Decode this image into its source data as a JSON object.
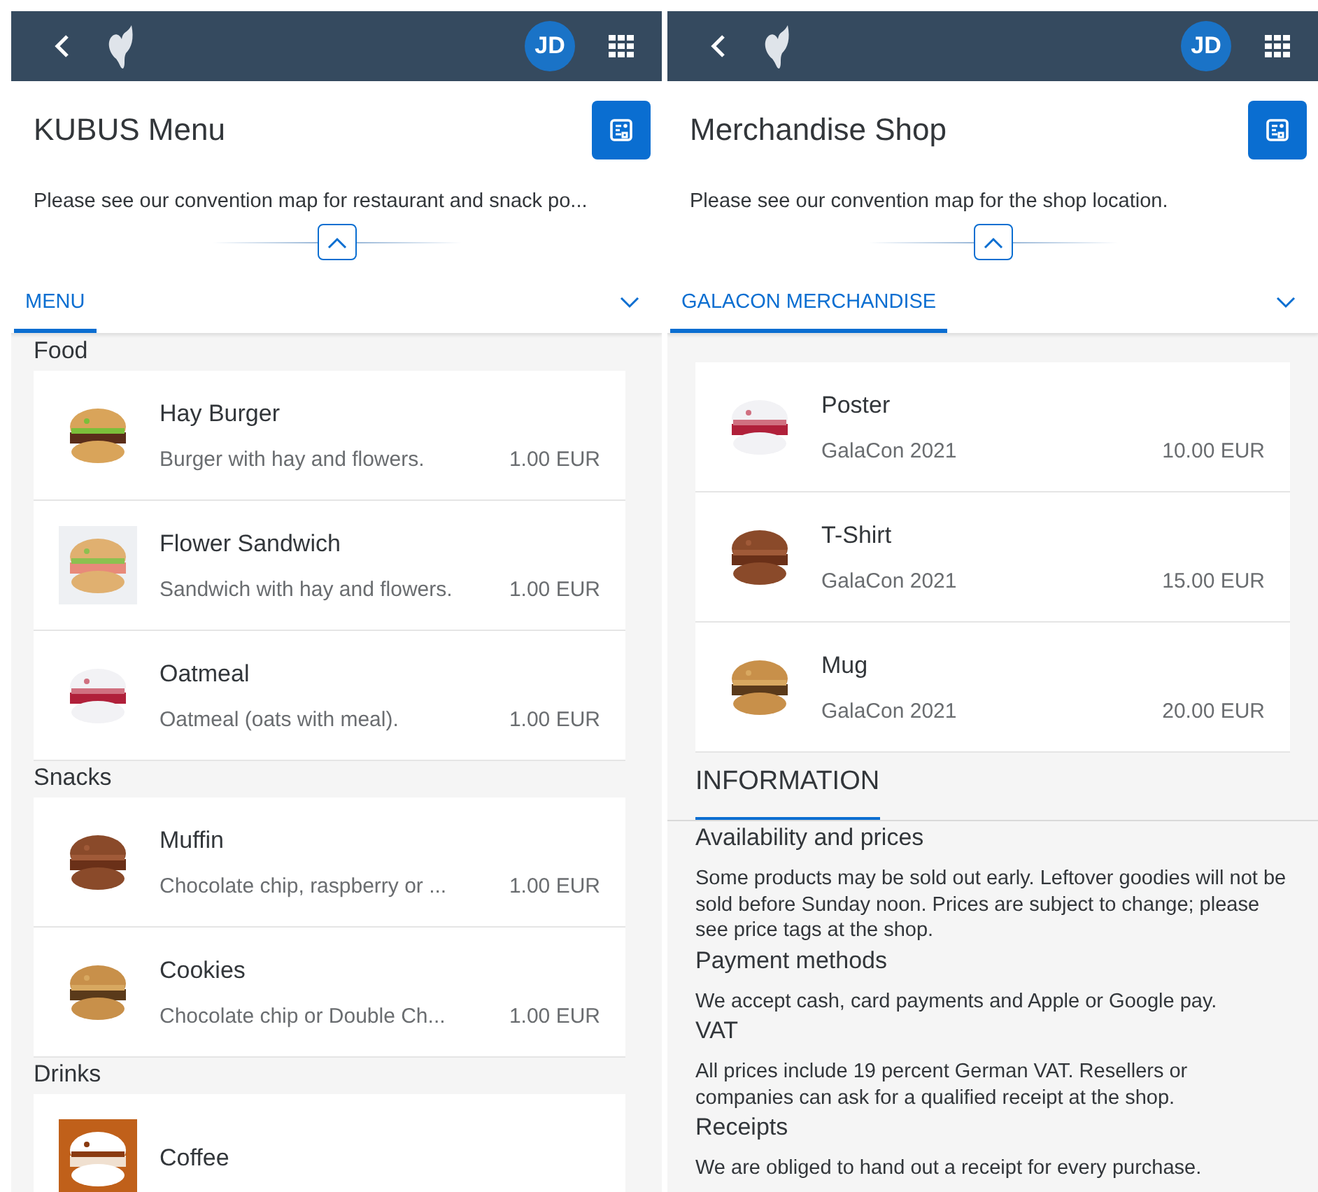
{
  "screens": [
    {
      "avatar": "JD",
      "title": "KUBUS Menu",
      "description": "Please see our convention map for restaurant and snack po...",
      "tabs": [
        {
          "label": "MENU",
          "selected": true
        }
      ],
      "groups": [
        {
          "title": "Food",
          "items": [
            {
              "name": "Hay Burger",
              "description": "Burger with hay and flowers.",
              "price": "1.00 EUR"
            },
            {
              "name": "Flower Sandwich",
              "description": "Sandwich with hay and flowers.",
              "price": "1.00 EUR"
            },
            {
              "name": "Oatmeal",
              "description": "Oatmeal (oats with meal).",
              "price": "1.00 EUR"
            }
          ]
        },
        {
          "title": "Snacks",
          "items": [
            {
              "name": "Muffin",
              "description": "Chocolate chip, raspberry or ...",
              "price": "1.00 EUR"
            },
            {
              "name": "Cookies",
              "description": "Chocolate chip or Double Ch...",
              "price": "1.00 EUR"
            }
          ]
        },
        {
          "title": "Drinks",
          "items": [
            {
              "name": "Coffee"
            }
          ]
        }
      ]
    },
    {
      "avatar": "JD",
      "title": "Merchandise Shop",
      "description": "Please see our convention map for the shop location.",
      "tabs": [
        {
          "label": "GALACON MERCHANDISE",
          "selected": true
        }
      ],
      "groups": [
        {
          "items": [
            {
              "name": "Poster",
              "description": "GalaCon 2021",
              "price": "10.00 EUR"
            },
            {
              "name": "T-Shirt",
              "description": "GalaCon 2021",
              "price": "15.00 EUR"
            },
            {
              "name": "Mug",
              "description": "GalaCon 2021",
              "price": "20.00 EUR"
            }
          ]
        }
      ],
      "info": {
        "tab": {
          "label": "INFORMATION",
          "selected": true
        },
        "sections": [
          {
            "heading": "Availability and prices",
            "text": "Some products may be sold out early. Leftover goodies will not be sold before Sunday noon. Prices are subject to change; please see price tags at the shop."
          },
          {
            "heading": "Payment methods",
            "text": "We accept cash, card payments and Apple or Google pay."
          },
          {
            "heading": "VAT",
            "text": "All prices include 19 percent German VAT. Resellers or companies can ask for a qualified receipt at the shop."
          },
          {
            "heading": "Receipts",
            "text": "We are obliged to hand out a receipt for every purchase."
          }
        ]
      }
    }
  ]
}
